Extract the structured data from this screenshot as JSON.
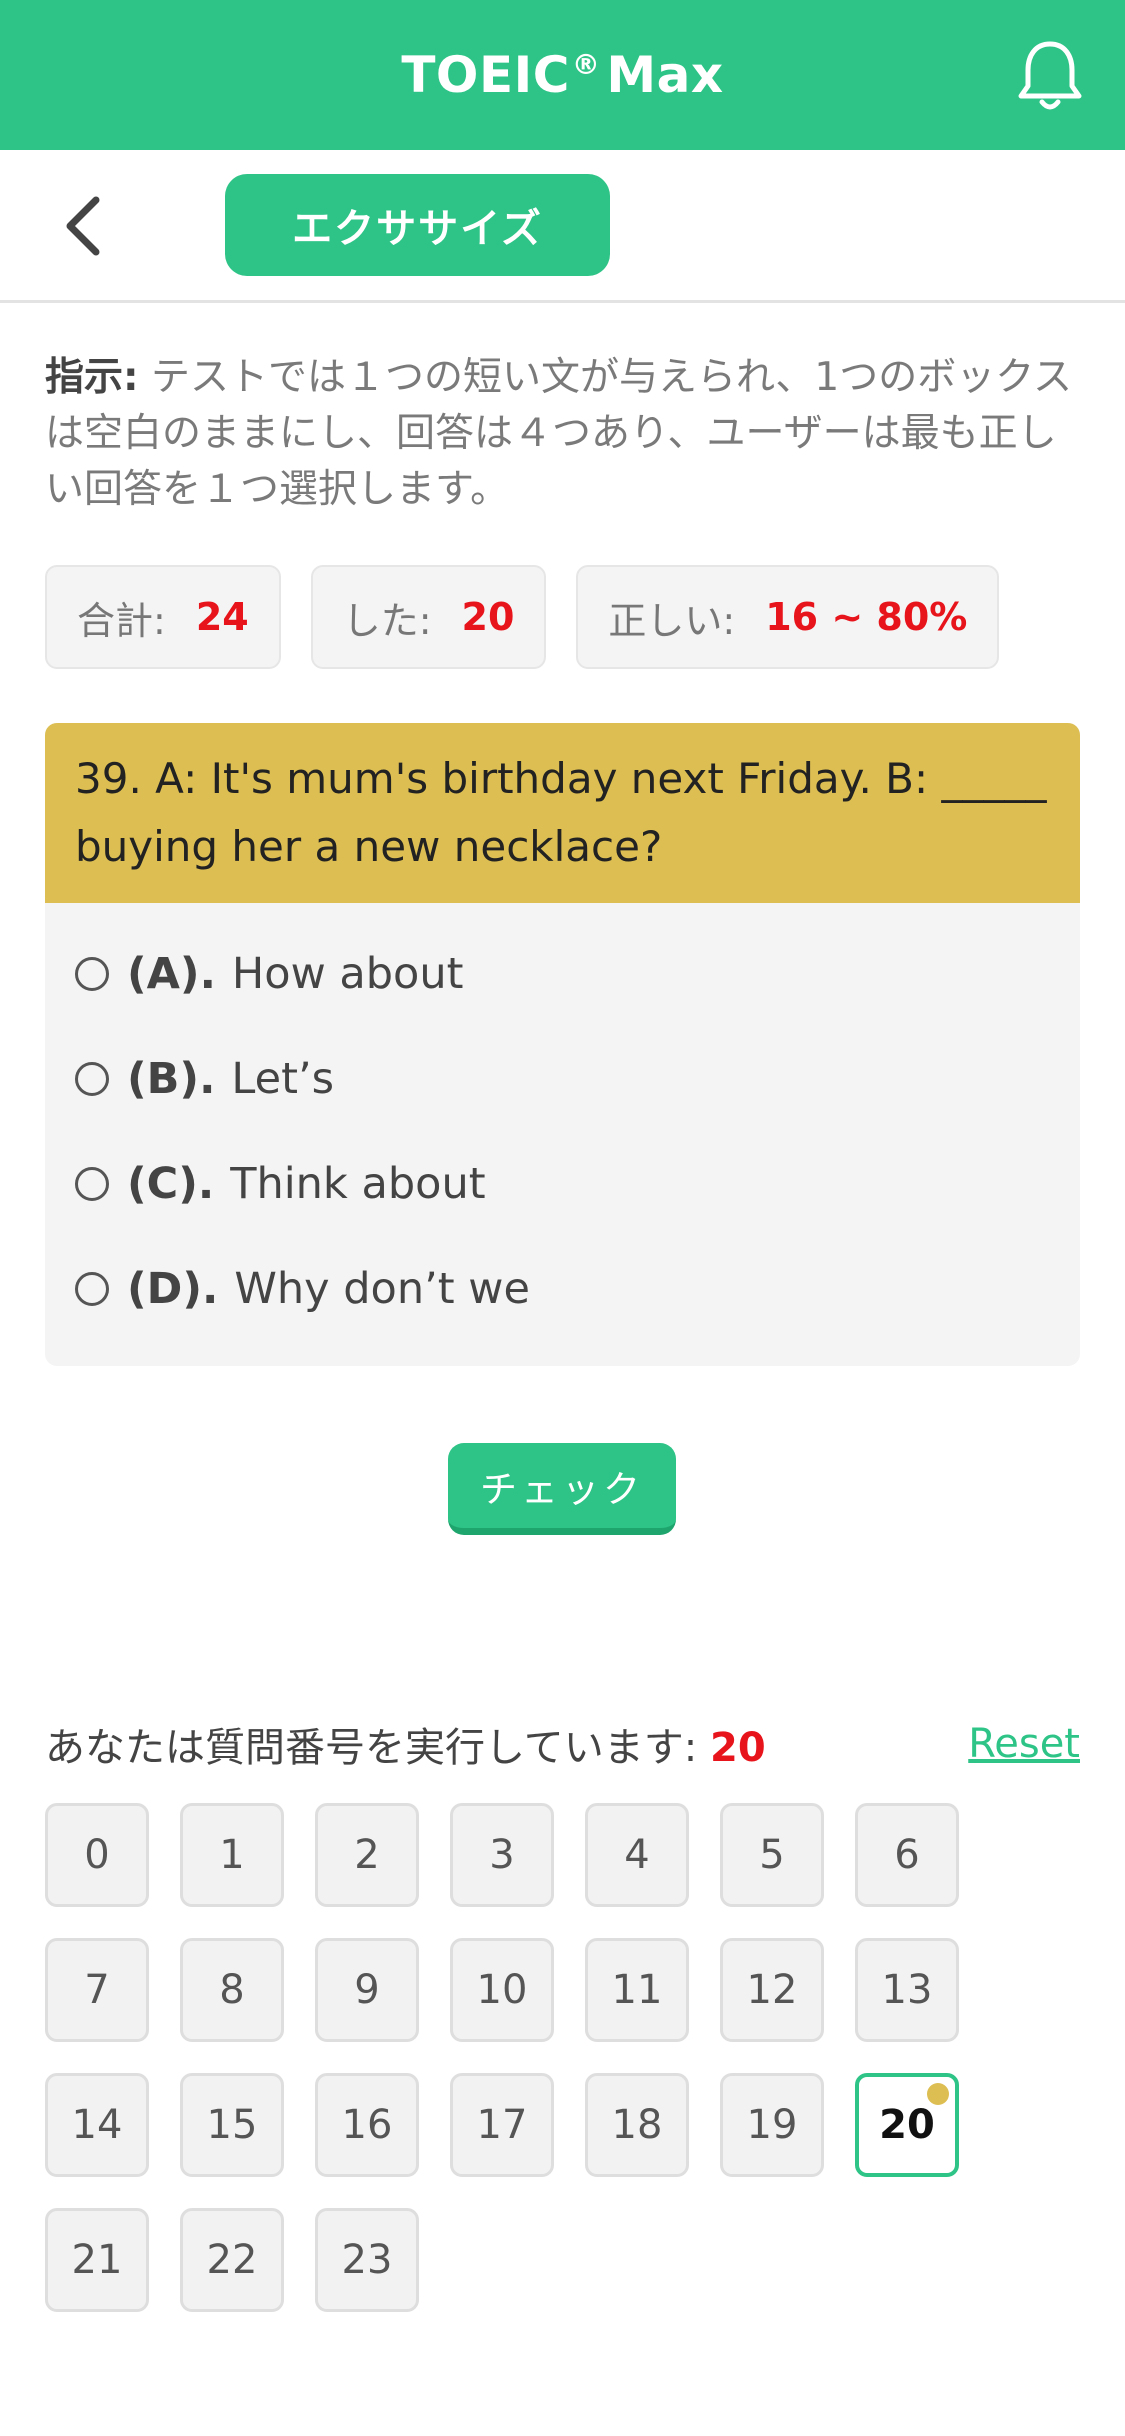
{
  "header": {
    "title_main": "TOEIC",
    "title_reg": "®",
    "title_suffix": "Max"
  },
  "subheader": {
    "tab_label": "エクササイズ"
  },
  "instructions": {
    "label": "指示:",
    "text": " テストでは１つの短い文が与えられ、1つのボックスは空白のままにし、回答は４つあり、ユーザーは最も正しい回答を１つ選択します。"
  },
  "stats": {
    "total_label": "合計:",
    "total_value": "24",
    "done_label": "した:",
    "done_value": "20",
    "correct_label": "正しい:",
    "correct_value": "16 ~ 80%"
  },
  "question": {
    "text": "39. A: It's mum's birthday next Friday. B: _____ buying her a new necklace?",
    "options": [
      {
        "letter": "(A).",
        "text": "How about"
      },
      {
        "letter": "(B).",
        "text": "Let’s"
      },
      {
        "letter": "(C).",
        "text": "Think about"
      },
      {
        "letter": "(D).",
        "text": "Why don’t we"
      }
    ]
  },
  "check_button": "チェック",
  "progress": {
    "label": "あなたは質問番号を実行しています:",
    "current": "20",
    "reset": "Reset"
  },
  "question_numbers": [
    "0",
    "1",
    "2",
    "3",
    "4",
    "5",
    "6",
    "7",
    "8",
    "9",
    "10",
    "11",
    "12",
    "13",
    "14",
    "15",
    "16",
    "17",
    "18",
    "19",
    "20",
    "21",
    "22",
    "23"
  ],
  "active_number": "20",
  "colors": {
    "accent": "#2ec487",
    "question_bg": "#dcbe52",
    "highlight": "#e8141c"
  }
}
